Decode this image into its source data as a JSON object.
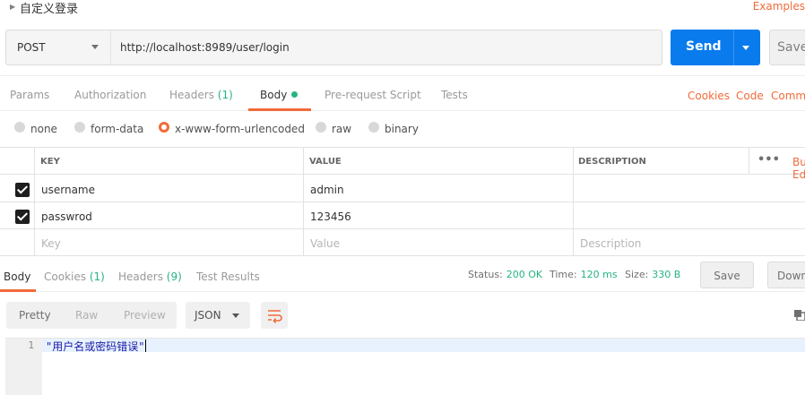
{
  "header": {
    "title": "自定义登录",
    "examples_link": "Examples"
  },
  "request": {
    "method": "POST",
    "url": "http://localhost:8989/user/login",
    "send_label": "Send",
    "save_label": "Save"
  },
  "request_tabs": {
    "params": "Params",
    "authorization": "Authorization",
    "headers": "Headers",
    "headers_count": "(1)",
    "body": "Body",
    "prerequest": "Pre-request Script",
    "tests": "Tests",
    "cookies": "Cookies",
    "code": "Code",
    "comments": "Comments"
  },
  "body_types": {
    "none": "none",
    "form_data": "form-data",
    "urlencoded": "x-www-form-urlencoded",
    "raw": "raw",
    "binary": "binary",
    "selected": "x-www-form-urlencoded"
  },
  "kv_table": {
    "headers": {
      "key": "KEY",
      "value": "VALUE",
      "description": "DESCRIPTION",
      "more": "•••",
      "bulk_edit": "Bulk Edit"
    },
    "rows": [
      {
        "checked": true,
        "key": "username",
        "value": "admin",
        "description": ""
      },
      {
        "checked": true,
        "key": "passwrod",
        "value": "123456",
        "description": ""
      }
    ],
    "placeholder": {
      "key": "Key",
      "value": "Value",
      "description": "Description"
    }
  },
  "response": {
    "tabs": {
      "body": "Body",
      "cookies": "Cookies",
      "cookies_count": "(1)",
      "headers": "Headers",
      "headers_count": "(9)",
      "test_results": "Test Results"
    },
    "status_label": "Status:",
    "status_value": "200 OK",
    "time_label": "Time:",
    "time_value": "120 ms",
    "size_label": "Size:",
    "size_value": "330 B",
    "save_label": "Save",
    "download_label": "Download"
  },
  "format": {
    "pretty": "Pretty",
    "raw": "Raw",
    "preview": "Preview",
    "language": "JSON"
  },
  "code": {
    "line_number": "1",
    "line_text": "\"用户名或密码错误\""
  },
  "colors": {
    "accent": "#f26b3a",
    "send_blue": "#097bed",
    "ok_green": "#26b47f"
  }
}
